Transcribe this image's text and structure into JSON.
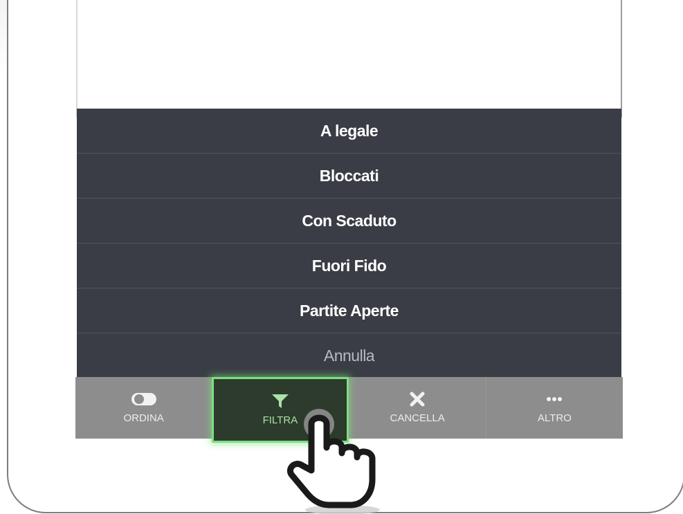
{
  "action_sheet": {
    "items": [
      {
        "label": "A legale"
      },
      {
        "label": "Bloccati"
      },
      {
        "label": "Con Scaduto"
      },
      {
        "label": "Fuori Fido"
      },
      {
        "label": "Partite Aperte"
      }
    ],
    "cancel_label": "Annulla"
  },
  "toolbar": {
    "items": [
      {
        "label": "ORDINA",
        "icon": "toggle-icon"
      },
      {
        "label": "FILTRA",
        "icon": "filter-icon",
        "active": true
      },
      {
        "label": "CANCELLA",
        "icon": "close-icon"
      },
      {
        "label": "ALTRO",
        "icon": "more-icon"
      }
    ]
  },
  "colors": {
    "sheet_bg": "#3a3d45",
    "toolbar_bg": "#8d8d8d",
    "active_bg": "#2d3b2c",
    "highlight": "#7ce07f"
  }
}
